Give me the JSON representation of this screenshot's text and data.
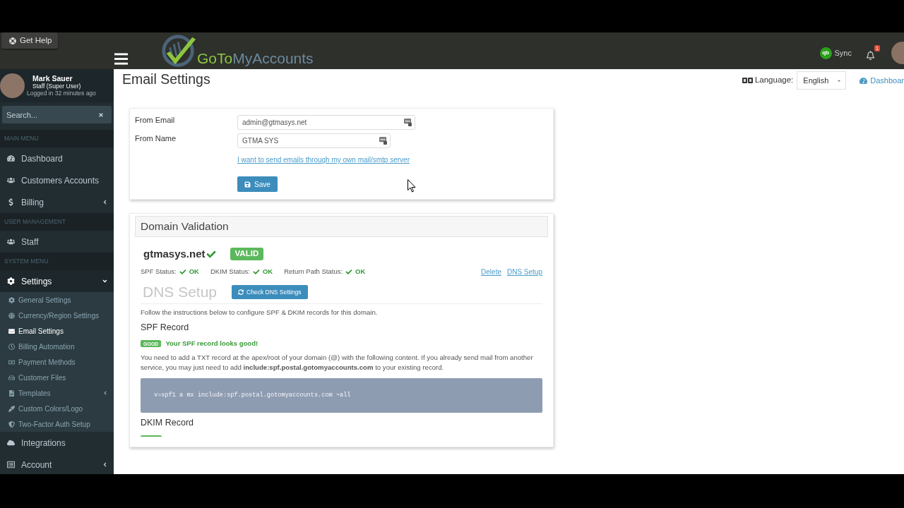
{
  "help_button": {
    "label": "Get Help"
  },
  "header": {
    "brand": [
      {
        "text": "GoTo",
        "color": "#8dc63f"
      },
      {
        "text": "MyAccounts",
        "color": "#6b8a9c"
      }
    ],
    "sync": {
      "logo_text": "qb",
      "label": "Sync"
    },
    "notifications": {
      "count": "1"
    }
  },
  "user_panel": {
    "name": "Mark Sauer",
    "role": "Staff (Super User)",
    "status": "Logged in 32 minutes ago"
  },
  "sidebar": {
    "search": {
      "placeholder": "Search..."
    },
    "sections": [
      {
        "title": "MAIN MENU",
        "items": [
          {
            "label": "Dashboard",
            "selected": false
          },
          {
            "label": "Customers Accounts",
            "selected": false
          },
          {
            "label": "Billing",
            "selected": false,
            "expanded": false
          }
        ]
      },
      {
        "title": "USER MANAGEMENT",
        "items": [
          {
            "label": "Staff",
            "selected": false
          }
        ]
      },
      {
        "title": "SYSTEM MENU",
        "items": [
          {
            "label": "Settings",
            "selected": true,
            "expanded": true,
            "children": [
              {
                "label": "General Settings",
                "selected": false
              },
              {
                "label": "Currency/Region Settings",
                "selected": false
              },
              {
                "label": "Email Settings",
                "selected": true
              },
              {
                "label": "Billing Automation",
                "selected": false
              },
              {
                "label": "Payment Methods",
                "selected": false
              },
              {
                "label": "Customer Files",
                "selected": false
              },
              {
                "label": "Templates",
                "selected": false,
                "expanded": false
              },
              {
                "label": "Custom Colors/Logo",
                "selected": false
              },
              {
                "label": "Two-Factor Auth Setup",
                "selected": false
              }
            ]
          },
          {
            "label": "Integrations",
            "selected": false
          },
          {
            "label": "Account",
            "selected": false,
            "expanded": false
          }
        ]
      }
    ]
  },
  "page": {
    "title": "Email Settings",
    "language": {
      "label": "Language:",
      "value": "English"
    },
    "breadcrumb": "Dashboar"
  },
  "email_form": {
    "fields": [
      {
        "label": "From Email",
        "value": "admin@gtmasys.net"
      },
      {
        "label": "From Name",
        "value": "GTMA SYS"
      }
    ],
    "smtp_link": "I want to send emails through my own mail/smtp server",
    "save_button": "Save"
  },
  "domain_validation": {
    "title": "Domain Validation",
    "domain": "gtmasys.net",
    "verified": true,
    "badge": "VALID",
    "statuses": [
      {
        "label": "SPF Status:",
        "value": "OK",
        "passed": true
      },
      {
        "label": "DKIM Status:",
        "value": "OK",
        "passed": true
      },
      {
        "label": "Return Path Status:",
        "value": "OK",
        "passed": true
      }
    ],
    "links": [
      "Delete",
      "DNS Setup"
    ],
    "dns_setup": {
      "title": "DNS Setup",
      "check_button": "Check DNS Settings",
      "instructions": "Follow the instructions below to configure SPF & DKIM records for this domain.",
      "spf": {
        "title": "SPF Record",
        "badge": "GOOD",
        "message": "Your SPF record looks good!",
        "description": "You need to add a TXT record at the apex/root of your domain (@) with the following content. If you already send mail from another service, you may just need to add **include:spf.postal.gotomyaccounts.com** to your existing record.",
        "record": "v=spf1 a mx include:spf.postal.gotomyaccounts.com ~all"
      },
      "dkim": {
        "title": "DKIM Record"
      }
    }
  }
}
